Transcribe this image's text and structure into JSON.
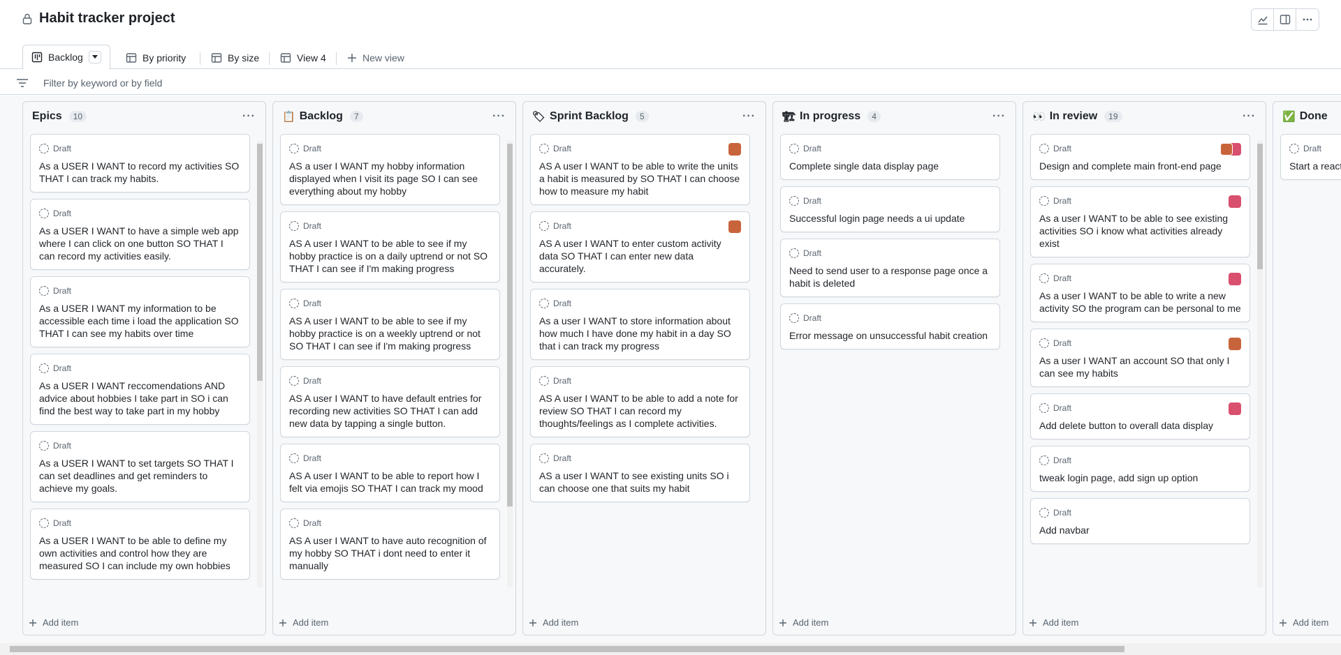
{
  "header": {
    "title": "Habit tracker project"
  },
  "views": [
    {
      "label": "Backlog",
      "icon": "board-icon",
      "active": true
    },
    {
      "label": "By priority",
      "icon": "table-icon"
    },
    {
      "label": "By size",
      "icon": "table-icon"
    },
    {
      "label": "View 4",
      "icon": "table-icon"
    },
    {
      "label": "New view",
      "icon": "plus-icon"
    }
  ],
  "filter": {
    "placeholder": "Filter by keyword or by field"
  },
  "draft_label": "Draft",
  "add_item_label": "Add item",
  "columns": [
    {
      "name": "Epics",
      "count": "10",
      "emoji": "",
      "cards": [
        {
          "text": "As a USER I WANT to record my activities SO THAT I can track my habits."
        },
        {
          "text": "As a USER I WANT to have a simple web app where I can click on one button SO THAT I can record my activities easily."
        },
        {
          "text": "As a USER I WANT my information to be accessible each time i load the application SO THAT I can see my habits over time"
        },
        {
          "text": "As a USER I WANT reccomendations AND advice about hobbies I take part in SO i can find the best way to take part in my hobby"
        },
        {
          "text": "As a USER I WANT to set targets SO THAT I can set deadlines and get reminders to achieve my goals."
        },
        {
          "text": "As a USER I WANT to be able to define my own activities and control how they are measured SO I can include my own hobbies"
        }
      ]
    },
    {
      "name": "Backlog",
      "count": "7",
      "emoji": "📋",
      "cards": [
        {
          "text": "AS a user I WANT my hobby information displayed when I visit its page SO I can see everything about my hobby"
        },
        {
          "text": "AS A user I WANT to be able to see if my hobby practice is on a daily uptrend or not SO THAT I can see if I'm making progress"
        },
        {
          "text": "AS A user I WANT to be able to see if my hobby practice is on a weekly uptrend or not SO THAT I can see if I'm making progress"
        },
        {
          "text": "AS A user I WANT to have default entries for recording new activities SO THAT I can add new data by tapping a single button."
        },
        {
          "text": "AS A user I WANT to be able to report how I felt via emojis SO THAT I can track my mood"
        },
        {
          "text": "AS A user I WANT to have auto recognition of my hobby SO THAT i dont need to enter it manually"
        }
      ]
    },
    {
      "name": "Sprint Backlog",
      "count": "5",
      "emoji": "🏷",
      "cards": [
        {
          "text": "AS A user I WANT to be able to write the units a habit is measured by SO THAT I can choose how to measure my habit",
          "avatar": "#c8643c"
        },
        {
          "text": "AS A user I WANT to enter custom activity data SO THAT I can enter new data accurately.",
          "avatar": "#c8643c"
        },
        {
          "text": "As a user I WANT to store information about how much I have done my habit in a day SO that i can track my progress"
        },
        {
          "text": "AS A user I WANT to be able to add a note for review SO THAT I can record my thoughts/feelings as I complete activities."
        },
        {
          "text": "AS a user I WANT to see existing units SO i can choose one that suits my habit"
        }
      ]
    },
    {
      "name": "In progress",
      "count": "4",
      "emoji": "🏗",
      "cards": [
        {
          "text": "Complete single data display page"
        },
        {
          "text": "Successful login page needs a ui update"
        },
        {
          "text": "Need to send user to a response page once a habit is deleted"
        },
        {
          "text": "Error message on unsuccessful habit creation"
        }
      ]
    },
    {
      "name": "In review",
      "count": "19",
      "emoji": "👀",
      "cards": [
        {
          "text": "Design and complete main front-end page",
          "avatar": "#d94f6e"
        },
        {
          "text": "As a user I WANT to be able to see existing activities SO i know what activities already exist",
          "avatar": "#d94f6e"
        },
        {
          "text": "As a user I WANT to be able to write a new activity SO the program can be personal to me",
          "avatar": "#d94f6e"
        },
        {
          "text": "As a user I WANT an account SO that only I can see my habits",
          "avatar": "#c8643c"
        },
        {
          "text": "Add delete button to overall data display",
          "avatar": "#d94f6e"
        },
        {
          "text": "tweak login page, add sign up option"
        },
        {
          "text": "Add navbar"
        }
      ]
    },
    {
      "name": "Done",
      "count": "",
      "emoji": "✅",
      "cards": [
        {
          "text": "Start a react"
        }
      ]
    }
  ]
}
